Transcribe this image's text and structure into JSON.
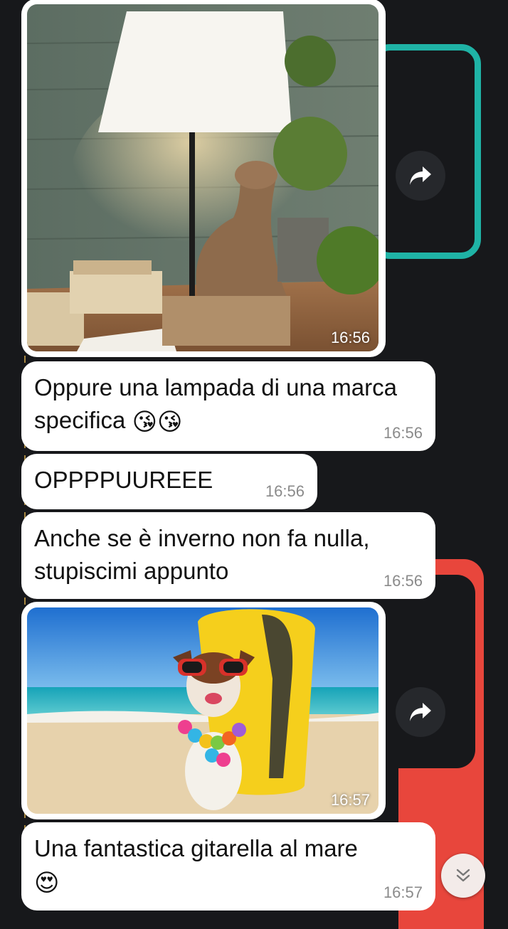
{
  "messages": [
    {
      "type": "image",
      "subject": "lampada con cane in legno",
      "time": "16:56"
    },
    {
      "type": "text",
      "text": "Oppure una lampada di una marca specifica",
      "emoji": "😘😘",
      "time": "16:56"
    },
    {
      "type": "text",
      "text": "OPPPPUUREEE",
      "time": "16:56"
    },
    {
      "type": "text",
      "text": "Anche se è inverno non fa nulla, stupiscimi appunto",
      "time": "16:56"
    },
    {
      "type": "image",
      "subject": "cane in spiaggia con occhiali e tavola da surf",
      "time": "16:57"
    },
    {
      "type": "text",
      "text": "Una fantastica gitarella al mare",
      "emoji": "😍",
      "time": "16:57"
    }
  ],
  "icons": {
    "forward": "forward-icon",
    "scroll": "chevron-double-down-icon"
  },
  "colors": {
    "background": "#17181b",
    "bubble": "#ffffff",
    "accent_teal": "#1fb3a6",
    "accent_red": "#e8463c"
  }
}
